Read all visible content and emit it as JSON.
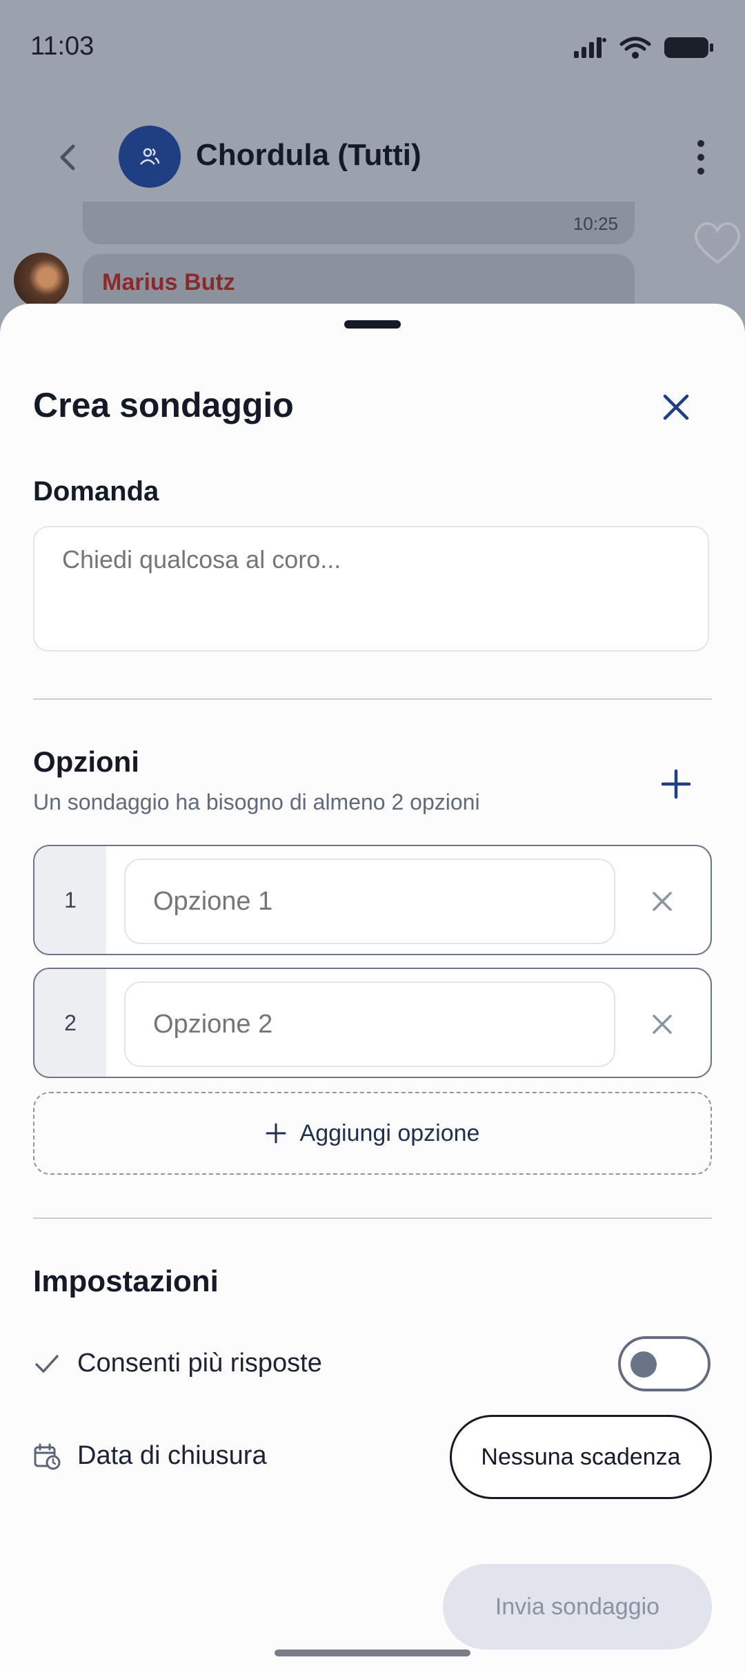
{
  "status_bar": {
    "time": "11:03"
  },
  "chat": {
    "title": "Chordula (Tutti)",
    "previous_message_time": "10:25",
    "sender_name": "Marius Butz"
  },
  "sheet": {
    "title": "Crea sondaggio",
    "question": {
      "label": "Domanda",
      "placeholder": "Chiedi qualcosa al coro..."
    },
    "options": {
      "label": "Opzioni",
      "hint": "Un sondaggio ha bisogno di almeno 2 opzioni",
      "items": [
        {
          "number": "1",
          "placeholder": "Opzione 1"
        },
        {
          "number": "2",
          "placeholder": "Opzione 2"
        }
      ],
      "add_label": "Aggiungi opzione"
    },
    "settings": {
      "label": "Impostazioni",
      "multiple_answers_label": "Consenti più risposte",
      "multiple_answers_enabled": false,
      "close_date_label": "Data di chiusura",
      "close_date_value": "Nessuna scadenza"
    },
    "send_label": "Invia sondaggio"
  },
  "colors": {
    "accent": "#1f3f82",
    "sender_name": "#8a2a2a",
    "scrim": "#9ba1ad",
    "disabled_button": "#e1e4ea"
  }
}
